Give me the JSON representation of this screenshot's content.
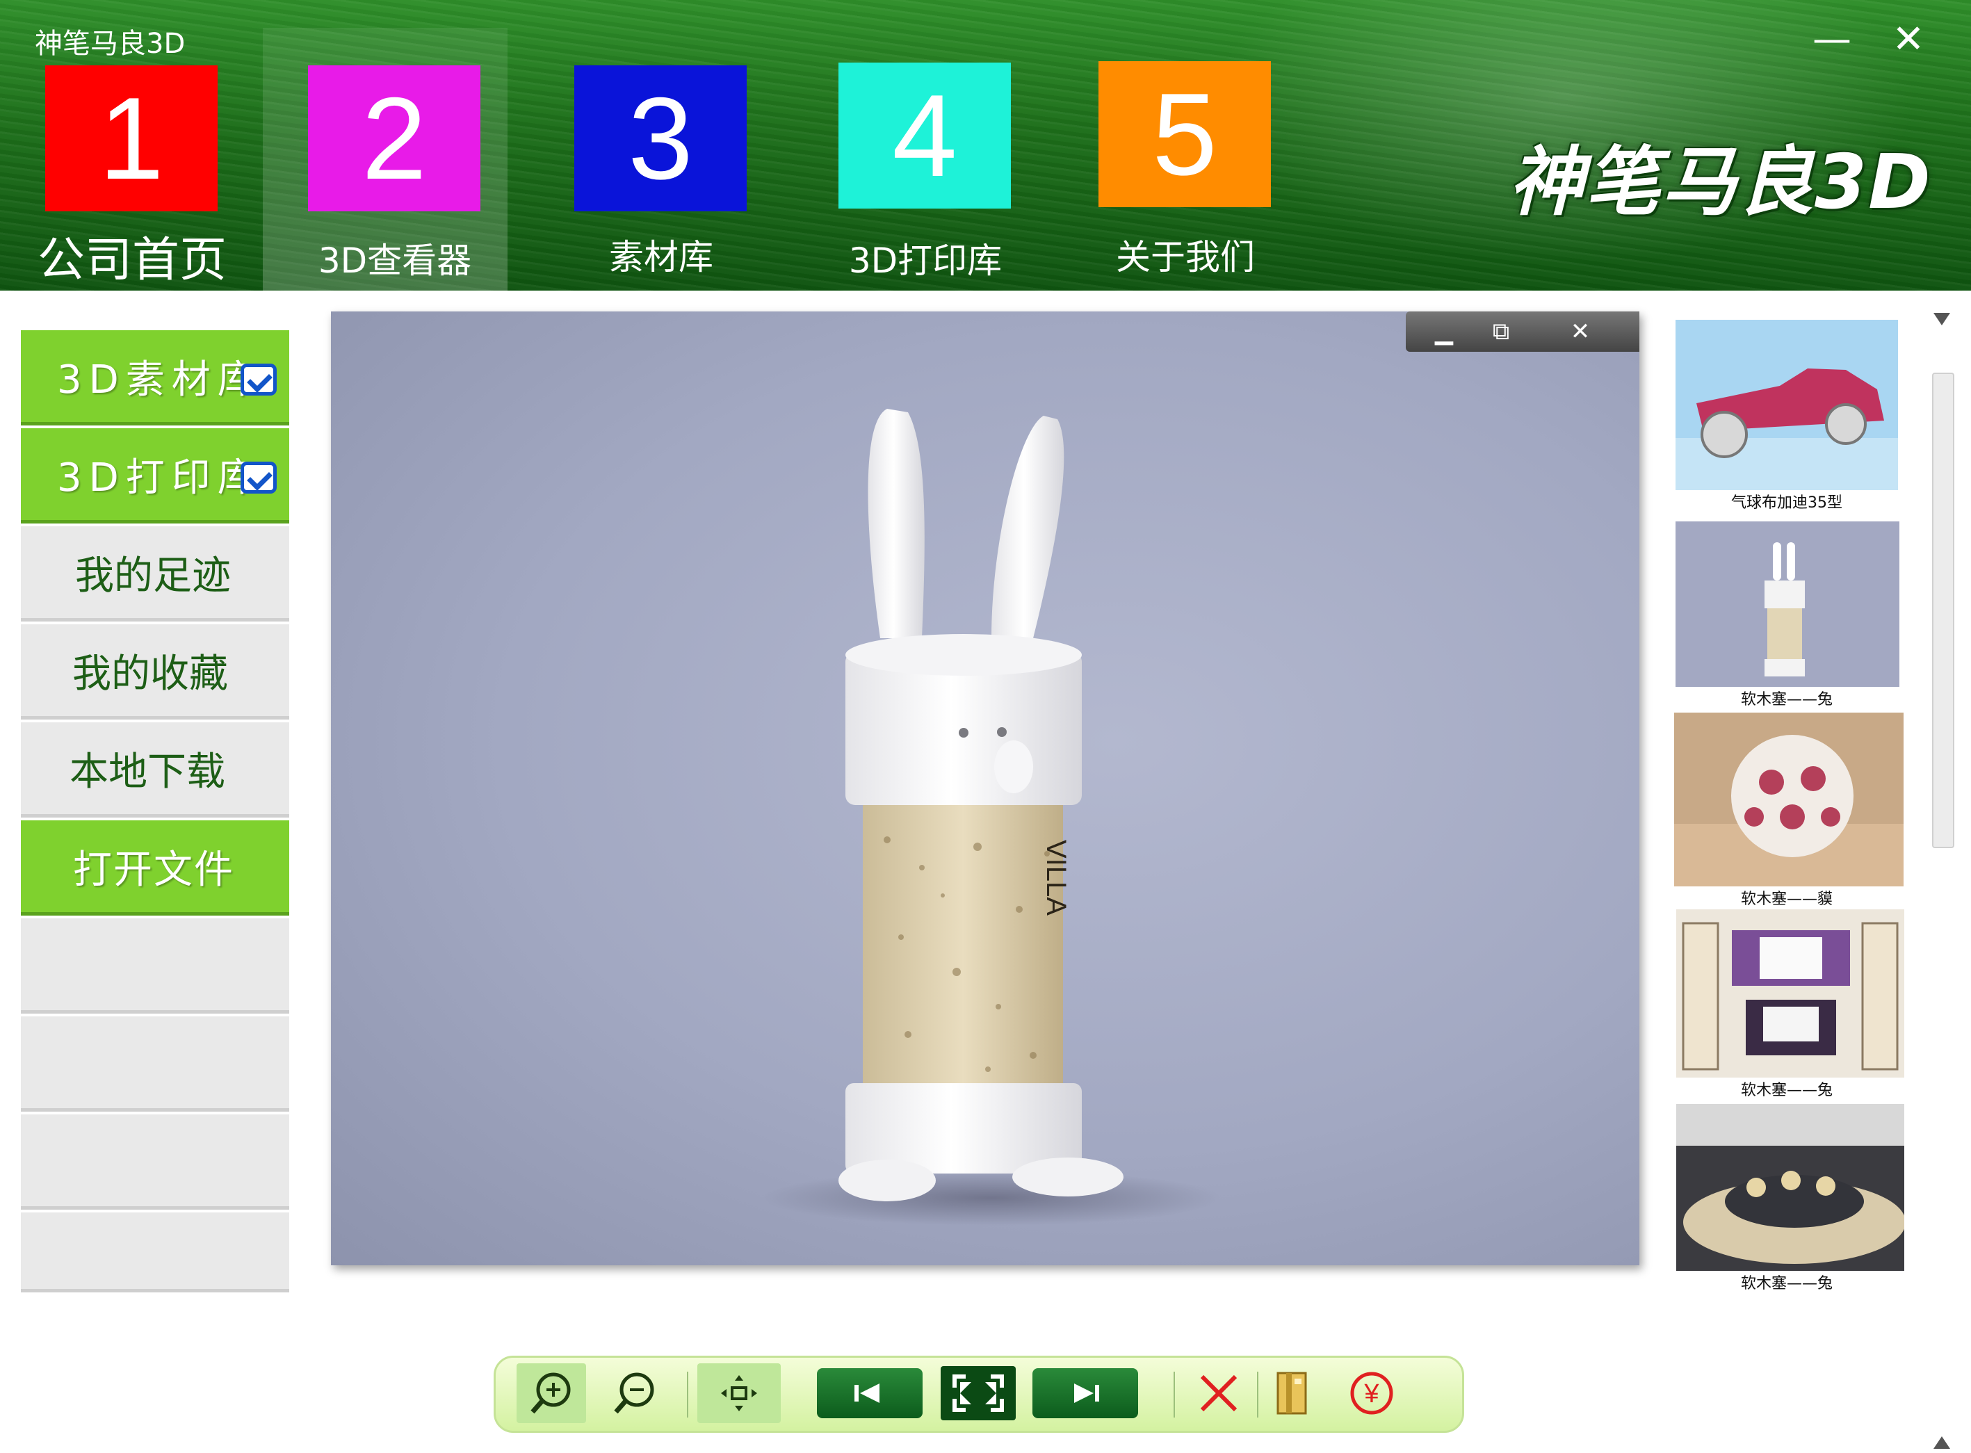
{
  "app": {
    "title": "神笔马良3D",
    "brand": "神笔马良3D",
    "minimize": "—",
    "close": "✕"
  },
  "tabs": [
    {
      "num": "1",
      "label": "公司首页",
      "color": "#ff0000"
    },
    {
      "num": "2",
      "label": "3D查看器",
      "color": "#e81be8"
    },
    {
      "num": "3",
      "label": "素材库",
      "color": "#0a14d9"
    },
    {
      "num": "4",
      "label": "3D打印库",
      "color": "#1ef2d8"
    },
    {
      "num": "5",
      "label": "关于我们",
      "color": "#ff8c00"
    }
  ],
  "active_tab": "2",
  "sidebar": {
    "items": [
      {
        "label": "3D素材库",
        "checked": true
      },
      {
        "label": "3D打印库",
        "checked": true
      },
      {
        "label": "我的足迹"
      },
      {
        "label": "我的收藏"
      },
      {
        "label": "本地下载"
      },
      {
        "label": "打开文件"
      }
    ]
  },
  "viewer": {
    "minimize": "▁",
    "restore": "⧉",
    "close": "✕",
    "cork_text": "VILLA"
  },
  "thumbnails": [
    {
      "caption": "气球布加迪35型"
    },
    {
      "caption": "软木塞——兔"
    },
    {
      "caption": "软木塞——貘"
    },
    {
      "caption": "软木塞——兔"
    },
    {
      "caption": "软木塞——兔"
    }
  ],
  "toolbar": {
    "zoom_in": "⊕",
    "zoom_out": "⊖",
    "center": "✥",
    "prev": "I◀",
    "fullscreen": "⛶",
    "next": "▶I",
    "delete": "✕",
    "yen": "¥"
  },
  "colors": {
    "accent_green": "#7fd12e",
    "header_green": "#1d6e1a"
  }
}
